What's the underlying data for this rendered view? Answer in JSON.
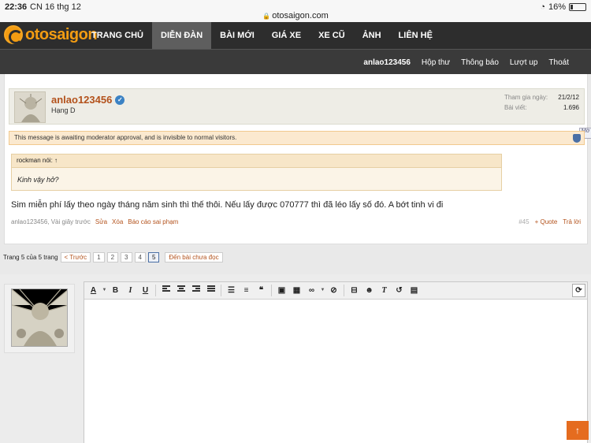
{
  "status": {
    "time": "22:36",
    "date": "CN 16 thg 12",
    "url": "otosaigon.com",
    "battery": "16%"
  },
  "site": {
    "logo": "otosaigon",
    "accent": "#f39c12"
  },
  "nav": [
    {
      "label": "TRANG CHỦ",
      "active": false
    },
    {
      "label": "DIỄN ĐÀN",
      "active": true
    },
    {
      "label": "BÀI MỚI",
      "active": false
    },
    {
      "label": "GIÁ XE",
      "active": false
    },
    {
      "label": "XE CŨ",
      "active": false
    },
    {
      "label": "ẢNH",
      "active": false
    },
    {
      "label": "LIÊN HỆ",
      "active": false
    }
  ],
  "subnav": {
    "user": "anlao123456",
    "inbox": "Hộp thư",
    "alerts": "Thông báo",
    "likes": "Lượt up",
    "logout": "Thoát"
  },
  "post": {
    "username": "anlao123456",
    "rank": "Hạng D",
    "joined_label": "Tham gia ngày:",
    "joined_value": "21/2/12",
    "posts_label": "Bài viết:",
    "posts_value": "1.696",
    "moderation": "This message is awaiting moderator approval, and is invisible to normal visitors.",
    "more_tab": "Mở",
    "quote_head": "rockman nói: ↑",
    "quote_body": "Kinh vậy hở?",
    "body": "Sim miễn phí lấy theo ngày tháng năm sinh thì thế thôi. Nếu lấy được 070777 thì đã léo lấy số đó. A bớt tinh vi đi",
    "meta_time": "anlao123456, Vài giây trước",
    "edit": "Sửa",
    "delete": "Xóa",
    "report": "Báo cáo sai phạm",
    "number": "#45",
    "quote_btn": "+ Quote",
    "reply_btn": "Trả lời"
  },
  "pager": {
    "label": "Trang 5 của 5 trang",
    "prev": "< Trước",
    "pages": [
      "1",
      "2",
      "3",
      "4",
      "5"
    ],
    "current": "5",
    "unread": "Đến bài chưa đọc"
  },
  "scroll_top": "↑"
}
